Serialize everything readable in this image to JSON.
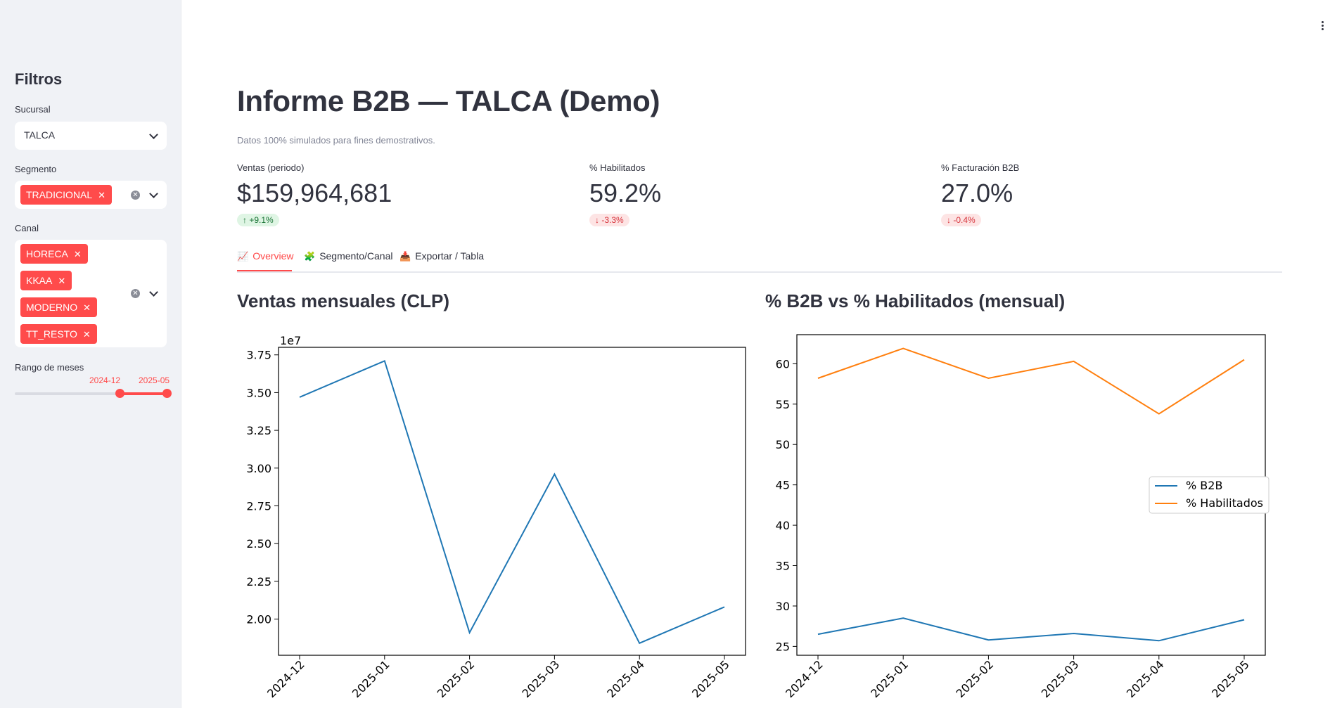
{
  "sidebar": {
    "title": "Filtros",
    "sucursal": {
      "label": "Sucursal",
      "value": "TALCA"
    },
    "segmento": {
      "label": "Segmento",
      "tags": [
        "TRADICIONAL"
      ]
    },
    "canal": {
      "label": "Canal",
      "tags": [
        "HORECA",
        "KKAA",
        "MODERNO",
        "TT_RESTO"
      ]
    },
    "rango": {
      "label": "Rango de meses",
      "start": "2024-12",
      "end": "2025-05"
    }
  },
  "header": {
    "title": "Informe B2B — TALCA (Demo)",
    "caption": "Datos 100% simulados para fines demostrativos."
  },
  "metrics": [
    {
      "label": "Ventas (periodo)",
      "value": "$159,964,681",
      "delta": "+9.1%",
      "direction": "up"
    },
    {
      "label": "% Habilitados",
      "value": "59.2%",
      "delta": "-3.3%",
      "direction": "down"
    },
    {
      "label": "% Facturación B2B",
      "value": "27.0%",
      "delta": "-0.4%",
      "direction": "down"
    }
  ],
  "tabs": [
    {
      "label": "Overview",
      "icon": "chart-icon",
      "active": true
    },
    {
      "label": "Segmento/Canal",
      "icon": "puzzle-icon",
      "active": false
    },
    {
      "label": "Exportar / Tabla",
      "icon": "download-tray-icon",
      "active": false
    }
  ],
  "colors": {
    "accent": "#ff4b4b",
    "series_blue": "#1f77b4",
    "series_orange": "#ff7f0e"
  },
  "chart_data": [
    {
      "type": "line",
      "title": "Ventas mensuales (CLP)",
      "scale_label": "1e7",
      "x": [
        "2024-12",
        "2025-01",
        "2025-02",
        "2025-03",
        "2025-04",
        "2025-05"
      ],
      "series": [
        {
          "values": [
            34700000,
            37100000,
            19100000,
            29600000,
            18400000,
            20800000
          ]
        }
      ],
      "yticks": [
        2.0,
        2.25,
        2.5,
        2.75,
        3.0,
        3.25,
        3.5,
        3.75
      ],
      "ytick_labels": [
        "2.00",
        "2.25",
        "2.50",
        "2.75",
        "3.00",
        "3.25",
        "3.50",
        "3.75"
      ],
      "ylim": [
        1.76,
        3.8
      ],
      "grid": false
    },
    {
      "type": "line",
      "title": "% B2B vs % Habilitados (mensual)",
      "x": [
        "2024-12",
        "2025-01",
        "2025-02",
        "2025-03",
        "2025-04",
        "2025-05"
      ],
      "series": [
        {
          "name": "% B2B",
          "values": [
            26.5,
            28.5,
            25.8,
            26.6,
            25.7,
            28.3
          ]
        },
        {
          "name": "% Habilitados",
          "values": [
            58.2,
            61.9,
            58.2,
            60.3,
            53.8,
            60.5
          ]
        }
      ],
      "yticks": [
        25,
        30,
        35,
        40,
        45,
        50,
        55,
        60
      ],
      "ylim": [
        23.9,
        63.6
      ],
      "legend": "center-right",
      "grid": false
    }
  ]
}
